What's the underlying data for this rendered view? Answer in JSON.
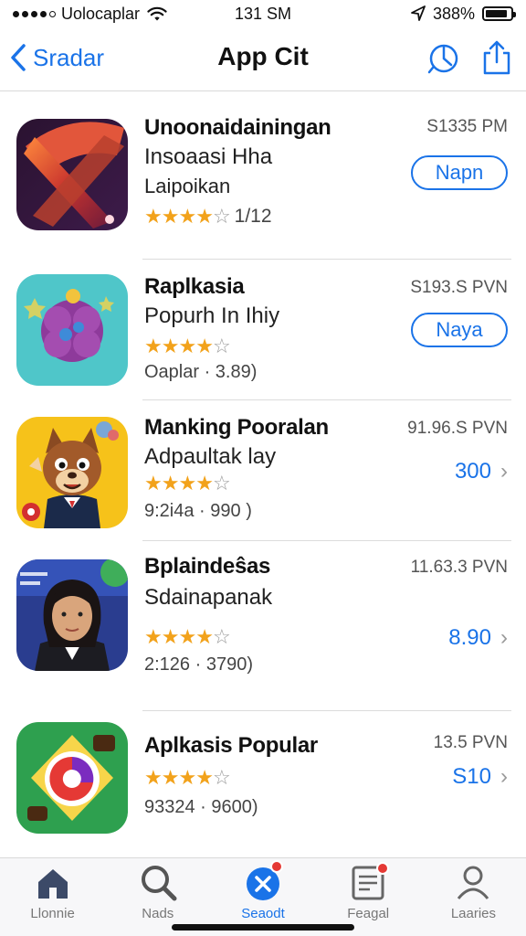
{
  "status_bar": {
    "carrier": "Uolocaplar",
    "time": "131 SM",
    "battery": "388%",
    "battery_level": 0.88,
    "icons": [
      "signal-dots",
      "wifi-icon",
      "location-arrow-icon",
      "battery-icon"
    ]
  },
  "nav": {
    "back_label": "Sradar",
    "title": "App Cit",
    "icons": [
      "chevron-left-icon",
      "activity-icon",
      "share-icon"
    ]
  },
  "apps": [
    {
      "name": "Unoonaidainingan",
      "subtitle": "Insoaasi Hha",
      "subtitle2": "Laipoikan",
      "time": "S1335 PM",
      "rating": 4,
      "rating_count": "1/12",
      "action": "Napn",
      "action_style": "pill",
      "icon": "abstract-x-icon"
    },
    {
      "name": "Raplkasia",
      "subtitle": "Popurh In Ihiy",
      "time": "S193.S PVN",
      "rating": 4,
      "meta": "Oaplar · 3.89)",
      "action": "Naya",
      "action_style": "pill",
      "icon": "purple-flower-icon"
    },
    {
      "name": "Manking Pooralan",
      "subtitle": "Adpaultak lay",
      "time": "91.96.S PVN",
      "rating": 4,
      "meta": "9:2i4a · 990 )",
      "action": "300",
      "action_style": "link",
      "icon": "cartoon-fox-icon"
    },
    {
      "name": "Bplaindeŝas",
      "subtitle": "Sdainapanak",
      "time": "11.63.3 PVN",
      "rating": 4,
      "meta": "2:126 · 3790)",
      "action": "8.90",
      "action_style": "link",
      "icon": "portrait-photo-icon"
    },
    {
      "name": "Aplkasis Popular",
      "time": "13.5 PVN",
      "rating": 4,
      "meta": "93324 · 9600)",
      "action": "S10",
      "action_style": "link",
      "icon": "colorful-logo-icon"
    }
  ],
  "tabs": [
    {
      "label": "Llonnie",
      "icon": "home-icon",
      "active": false
    },
    {
      "label": "Nads",
      "icon": "search-icon",
      "active": false
    },
    {
      "label": "Seaodt",
      "icon": "x-circle-icon",
      "active": true,
      "badge": true
    },
    {
      "label": "Feagal",
      "icon": "inbox-icon",
      "active": false,
      "badge": true
    },
    {
      "label": "Laaries",
      "icon": "person-icon",
      "active": false
    }
  ],
  "colors": {
    "accent": "#1a73e8",
    "star": "#f2a21b",
    "badge": "#e53935"
  }
}
